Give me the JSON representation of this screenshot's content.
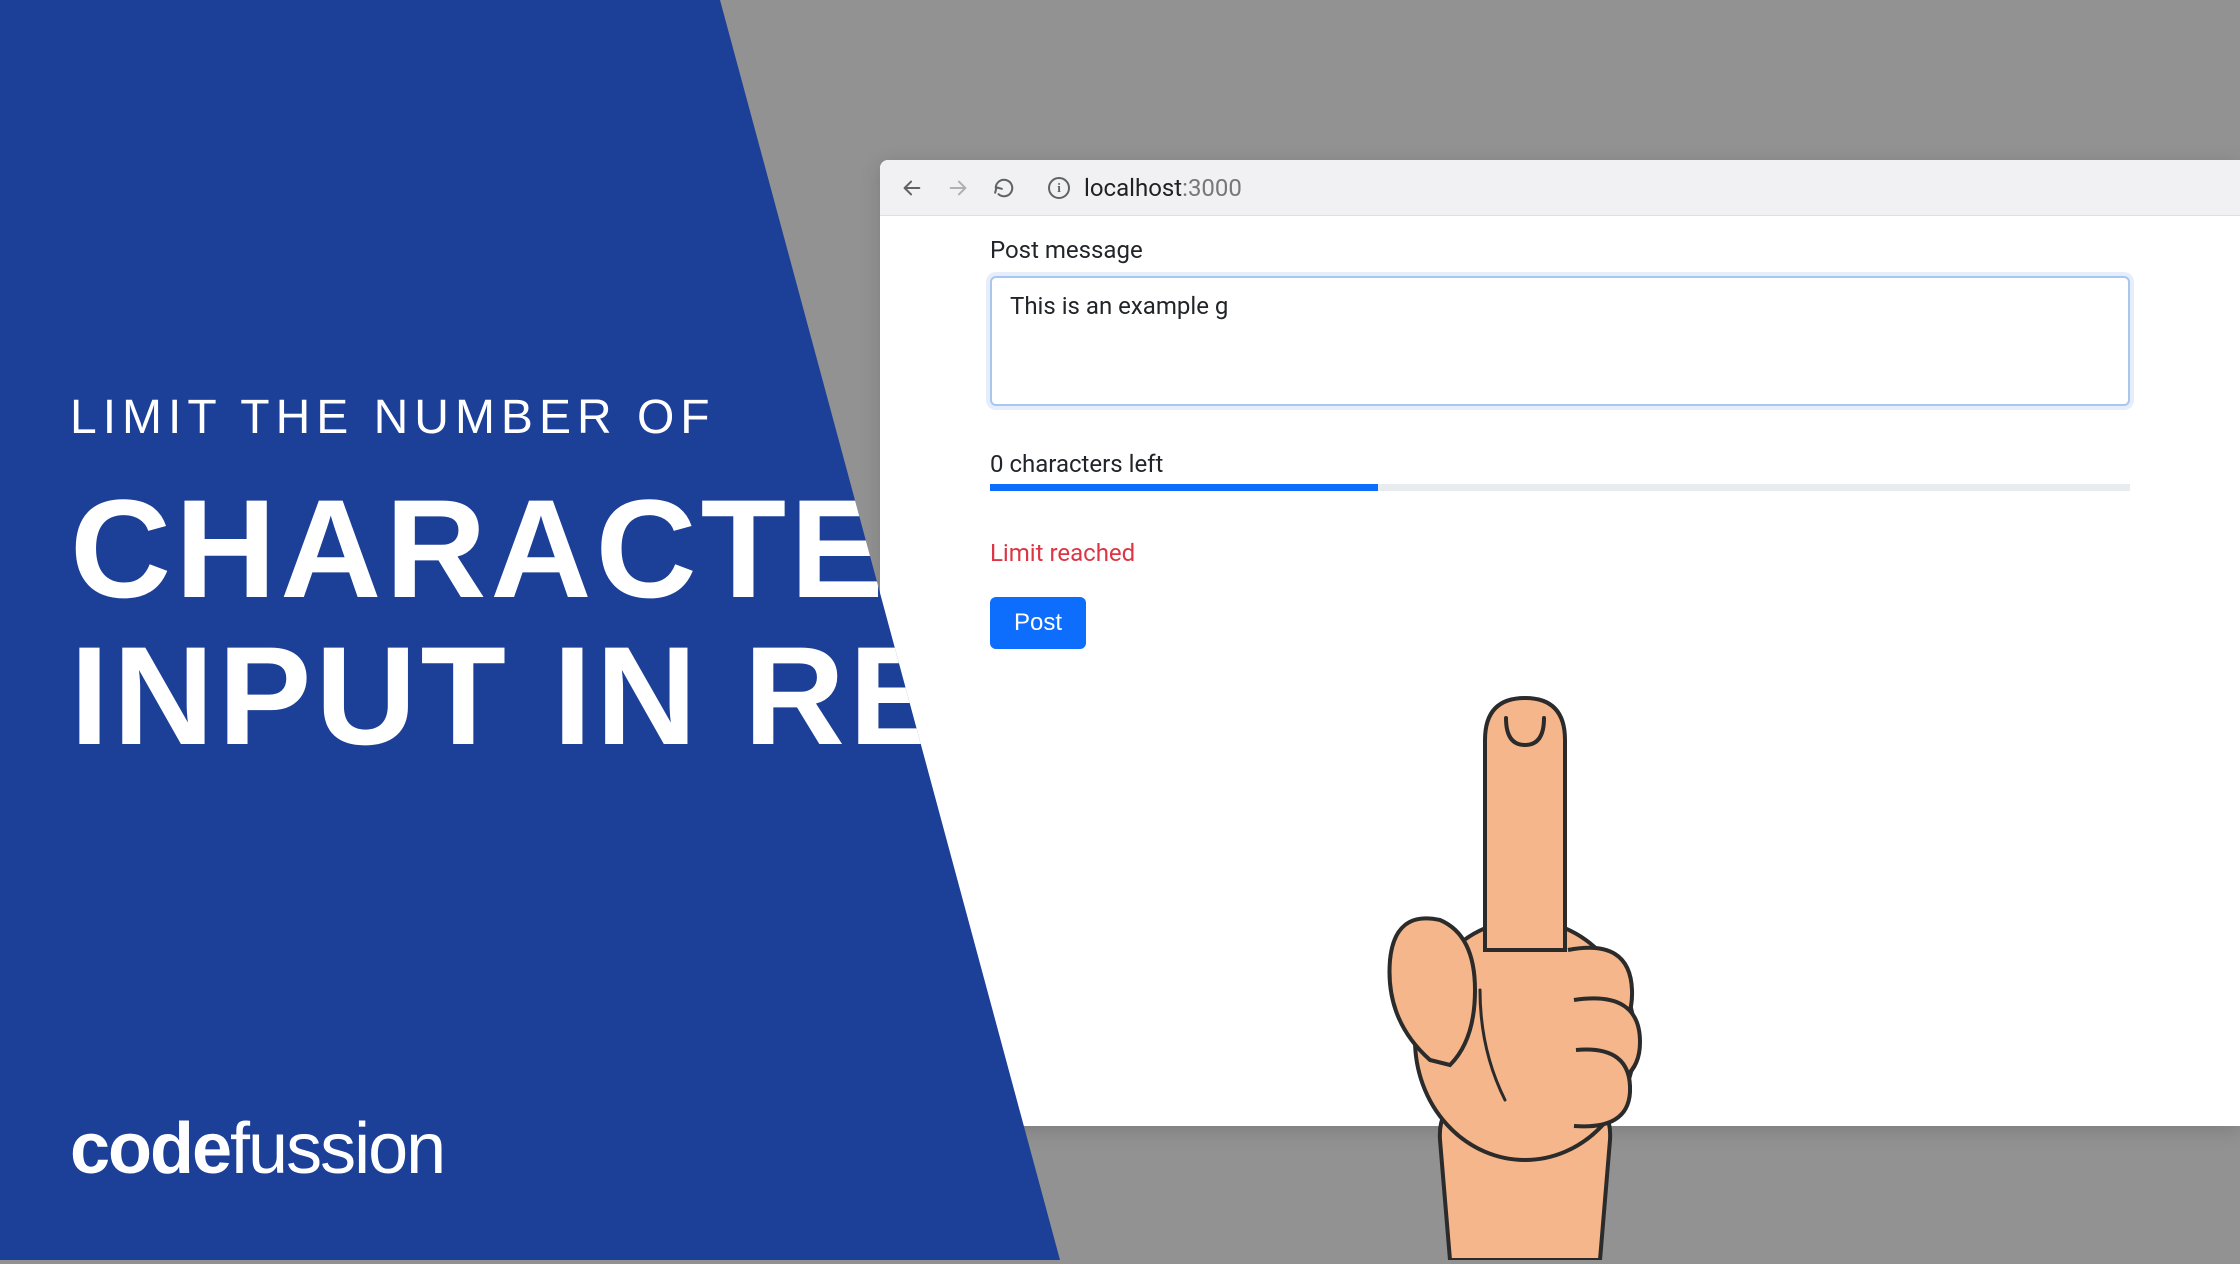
{
  "hero": {
    "subtitle": "LIMIT THE NUMBER OF",
    "title_line1": "CHARACTER",
    "title_line2": "INPUT IN REACT",
    "brand": "codefussion"
  },
  "browser": {
    "url_host": "localhost",
    "url_port": ":3000"
  },
  "form": {
    "label": "Post message",
    "textarea_value": "This is an example g",
    "chars_left_text": "0 characters left",
    "limit_warning": "Limit reached",
    "post_button_label": "Post",
    "progress_percent": 34
  },
  "colors": {
    "primary_blue": "#1C3F98",
    "button_blue": "#0d6efd",
    "danger_red": "#dc3545"
  }
}
